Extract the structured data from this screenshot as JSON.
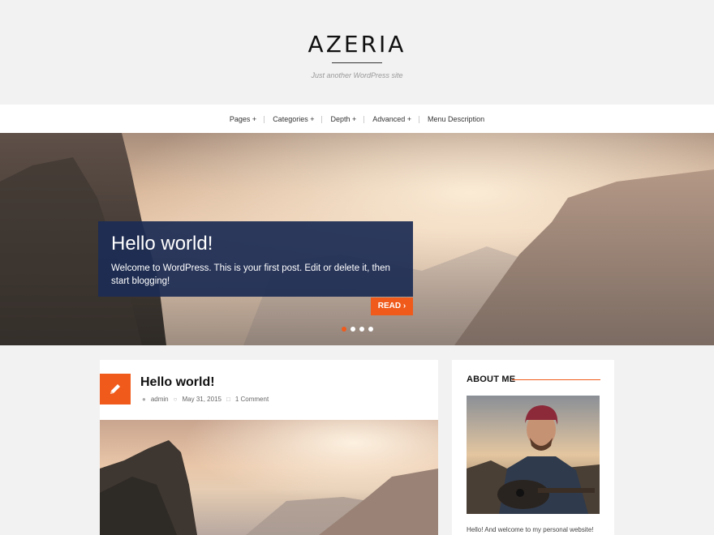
{
  "site": {
    "title": "AZERIA",
    "description": "Just another WordPress site"
  },
  "nav": {
    "items": [
      {
        "label": "Pages +"
      },
      {
        "label": "Categories +"
      },
      {
        "label": "Depth +"
      },
      {
        "label": "Advanced +"
      },
      {
        "label": "Menu Description"
      }
    ]
  },
  "slider": {
    "title": "Hello world!",
    "excerpt": "Welcome to WordPress. This is your first post. Edit or delete it, then start blogging!",
    "read_label": "READ ›",
    "active_dot": 1,
    "dot_count": 4
  },
  "post": {
    "title": "Hello world!",
    "author": "admin",
    "date": "May 31, 2015",
    "comments": "1 Comment",
    "icon": "pencil-icon"
  },
  "sidebar": {
    "widget_title": "ABOUT ME",
    "about_text": "Hello! And welcome to my personal website!"
  },
  "colors": {
    "accent": "#f05a1a",
    "slider_box": "#1c2c54",
    "background": "#f2f2f2"
  }
}
